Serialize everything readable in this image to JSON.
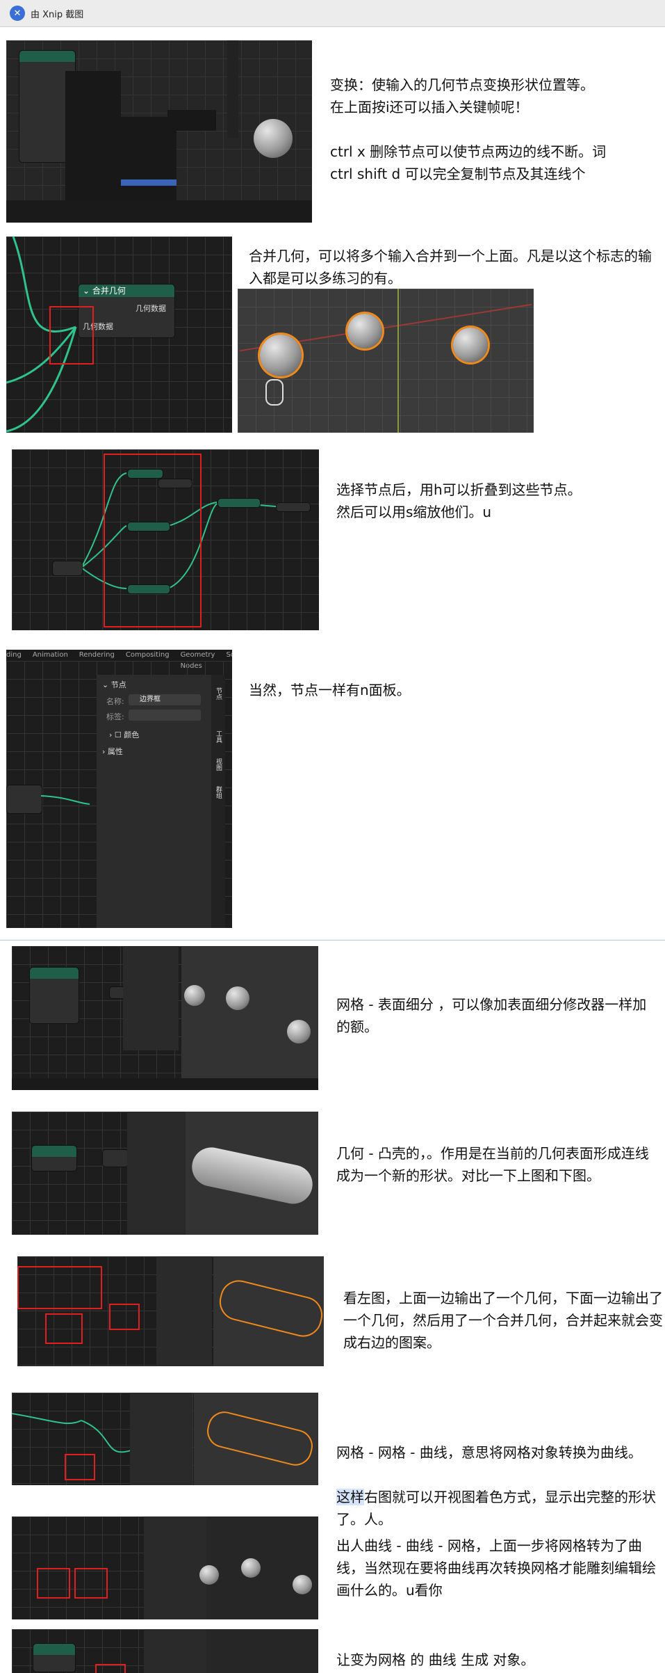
{
  "window": {
    "title": "由 Xnip 截图"
  },
  "notes": {
    "n1": "变换：使输入的几何节点变换形状位置等。\n在上面按i还可以插入关键帧呢！\n\nctrl x 删除节点可以使节点两边的线不断。词\nctrl shift d 可以完全复制节点及其连线个",
    "n2": "合并几何，可以将多个输入合并到一个上面。凡是以这个标志的输入都是可以多练习的有。",
    "n3": "选择节点后，用h可以折叠到这些节点。\n然后可以用s缩放他们。u",
    "n4": "当然，节点一样有n面板。",
    "n5": "网格 - 表面细分 ，可以像加表面细分修改器一样加的额。",
    "n6": "几何 - 凸壳的，。作用是在当前的几何表面形成连线成为一个新的形状。对比一下上图和下图。",
    "n7": "看左图，上面一边输出了一个几何，下面一边输出了一个几何，然后用了一个合并几何，合并起来就会变成右边的图案。",
    "n8_hl": "这样",
    "n8a": "网格 - 网格 - 曲线，意思将网格对象转换为曲线。",
    "n8b": "右图就可以开视图着色方式，显示出完整的形状了。人。",
    "n9": "出人曲线 - 曲线 - 网格，上面一步将网格转为了曲线，当然现在要将曲线再次转换网格才能雕刻编辑绘画什么的。u看你",
    "n10": "让变为网格 的 曲线 生成 对象。"
  },
  "shot2": {
    "node_title": "合并几何",
    "out_socket": "几何数据",
    "in_socket": "几何数据"
  },
  "shot4": {
    "tabs": [
      "ding",
      "Animation",
      "Rendering",
      "Compositing",
      "Geometry Nodes",
      "Scri"
    ],
    "section": "节点",
    "name_label": "名称:",
    "name_value": "边界框",
    "label_label": "标签:",
    "color_label": "颜色",
    "props_label": "属性",
    "side_tabs": [
      "节点",
      "工具",
      "视图",
      "群组"
    ]
  },
  "colors": {
    "node_link": "#2ec48c",
    "select_outline": "#f08a1a",
    "annotation_red": "#e02020"
  }
}
